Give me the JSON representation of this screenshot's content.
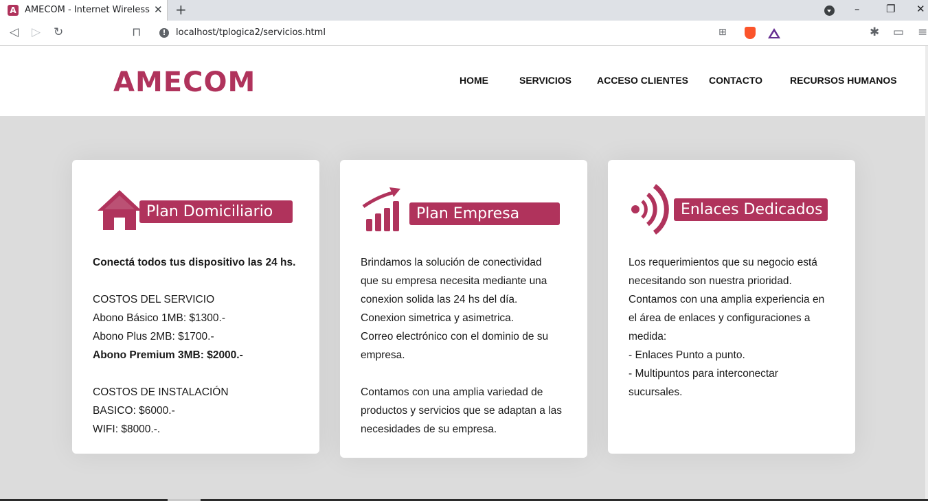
{
  "browser": {
    "tab_title": "AMECOM - Internet Wireless",
    "url": "localhost/tplogica2/servicios.html"
  },
  "site": {
    "logo": "AMECOM",
    "nav": [
      "HOME",
      "SERVICIOS",
      "ACCESO CLIENTES",
      "CONTACTO",
      "RECURSOS HUMANOS"
    ]
  },
  "cards": [
    {
      "title": "Plan Domiciliario",
      "lines": [
        "Conectá todos tus dispositivo las 24 hs.",
        "COSTOS DEL SERVICIO",
        "Abono Básico 1MB: $1300.-",
        "Abono Plus 2MB: $1700.-",
        "Abono Premium 3MB: $2000.-",
        "COSTOS DE INSTALACIÓN",
        "BASICO: $6000.-",
        "WIFI: $8000.-."
      ]
    },
    {
      "title": "Plan Empresa",
      "lines": [
        "Brindamos la solución de conectividad",
        "que su empresa necesita mediante una",
        "conexion solida las 24 hs del día.",
        "Conexion simetrica y asimetrica.",
        "Correo electrónico con el dominio de su",
        "empresa.",
        "Contamos con una amplia variedad de",
        "productos y servicios que se adaptan a las",
        "necesidades de su empresa."
      ]
    },
    {
      "title": "Enlaces Dedicados",
      "lines": [
        "Los requerimientos que su negocio está",
        "necesitando son nuestra prioridad.",
        "Contamos con una amplia experiencia en",
        "el área de enlaces y configuraciones a",
        "medida:",
        "- Enlaces Punto a punto.",
        "- Multipuntos para interconectar",
        "sucursales."
      ]
    }
  ],
  "colors": {
    "brand": "#b0335c",
    "page_background": "#dcdcdc"
  },
  "icons": [
    "house-icon",
    "growth-chart-icon",
    "wireless-signal-icon"
  ]
}
